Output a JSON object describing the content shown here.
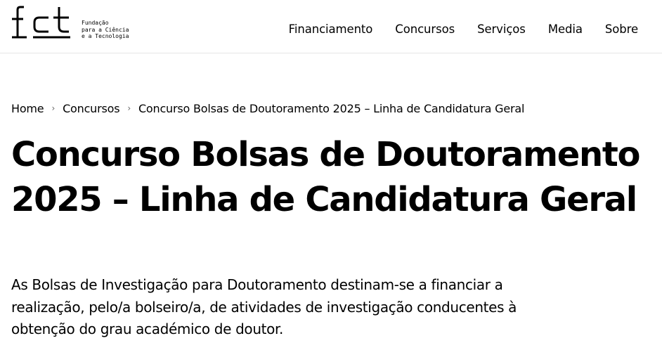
{
  "header": {
    "logo_mark": "fct",
    "logo_text_line1": "Fundação",
    "logo_text_line2": "para a Ciência",
    "logo_text_line3": "e a Tecnologia",
    "nav": [
      {
        "label": "Financiamento"
      },
      {
        "label": "Concursos"
      },
      {
        "label": "Serviços"
      },
      {
        "label": "Media"
      },
      {
        "label": "Sobre"
      }
    ]
  },
  "breadcrumb": {
    "items": [
      {
        "label": "Home"
      },
      {
        "label": "Concursos"
      },
      {
        "label": "Concurso Bolsas de Doutoramento 2025 – Linha de Candidatura Geral"
      }
    ],
    "separator": "›"
  },
  "main": {
    "title_line1": "Concurso Bolsas de Doutoramento",
    "title_line2": "2025 – Linha de Candidatura Geral",
    "intro_line1": "As Bolsas de Investigação para Doutoramento destinam-se a financiar a",
    "intro_line2": "realização, pelo/a bolseiro/a, de atividades de investigação conducentes à",
    "intro_line3": "obtenção do grau académico de doutor."
  }
}
